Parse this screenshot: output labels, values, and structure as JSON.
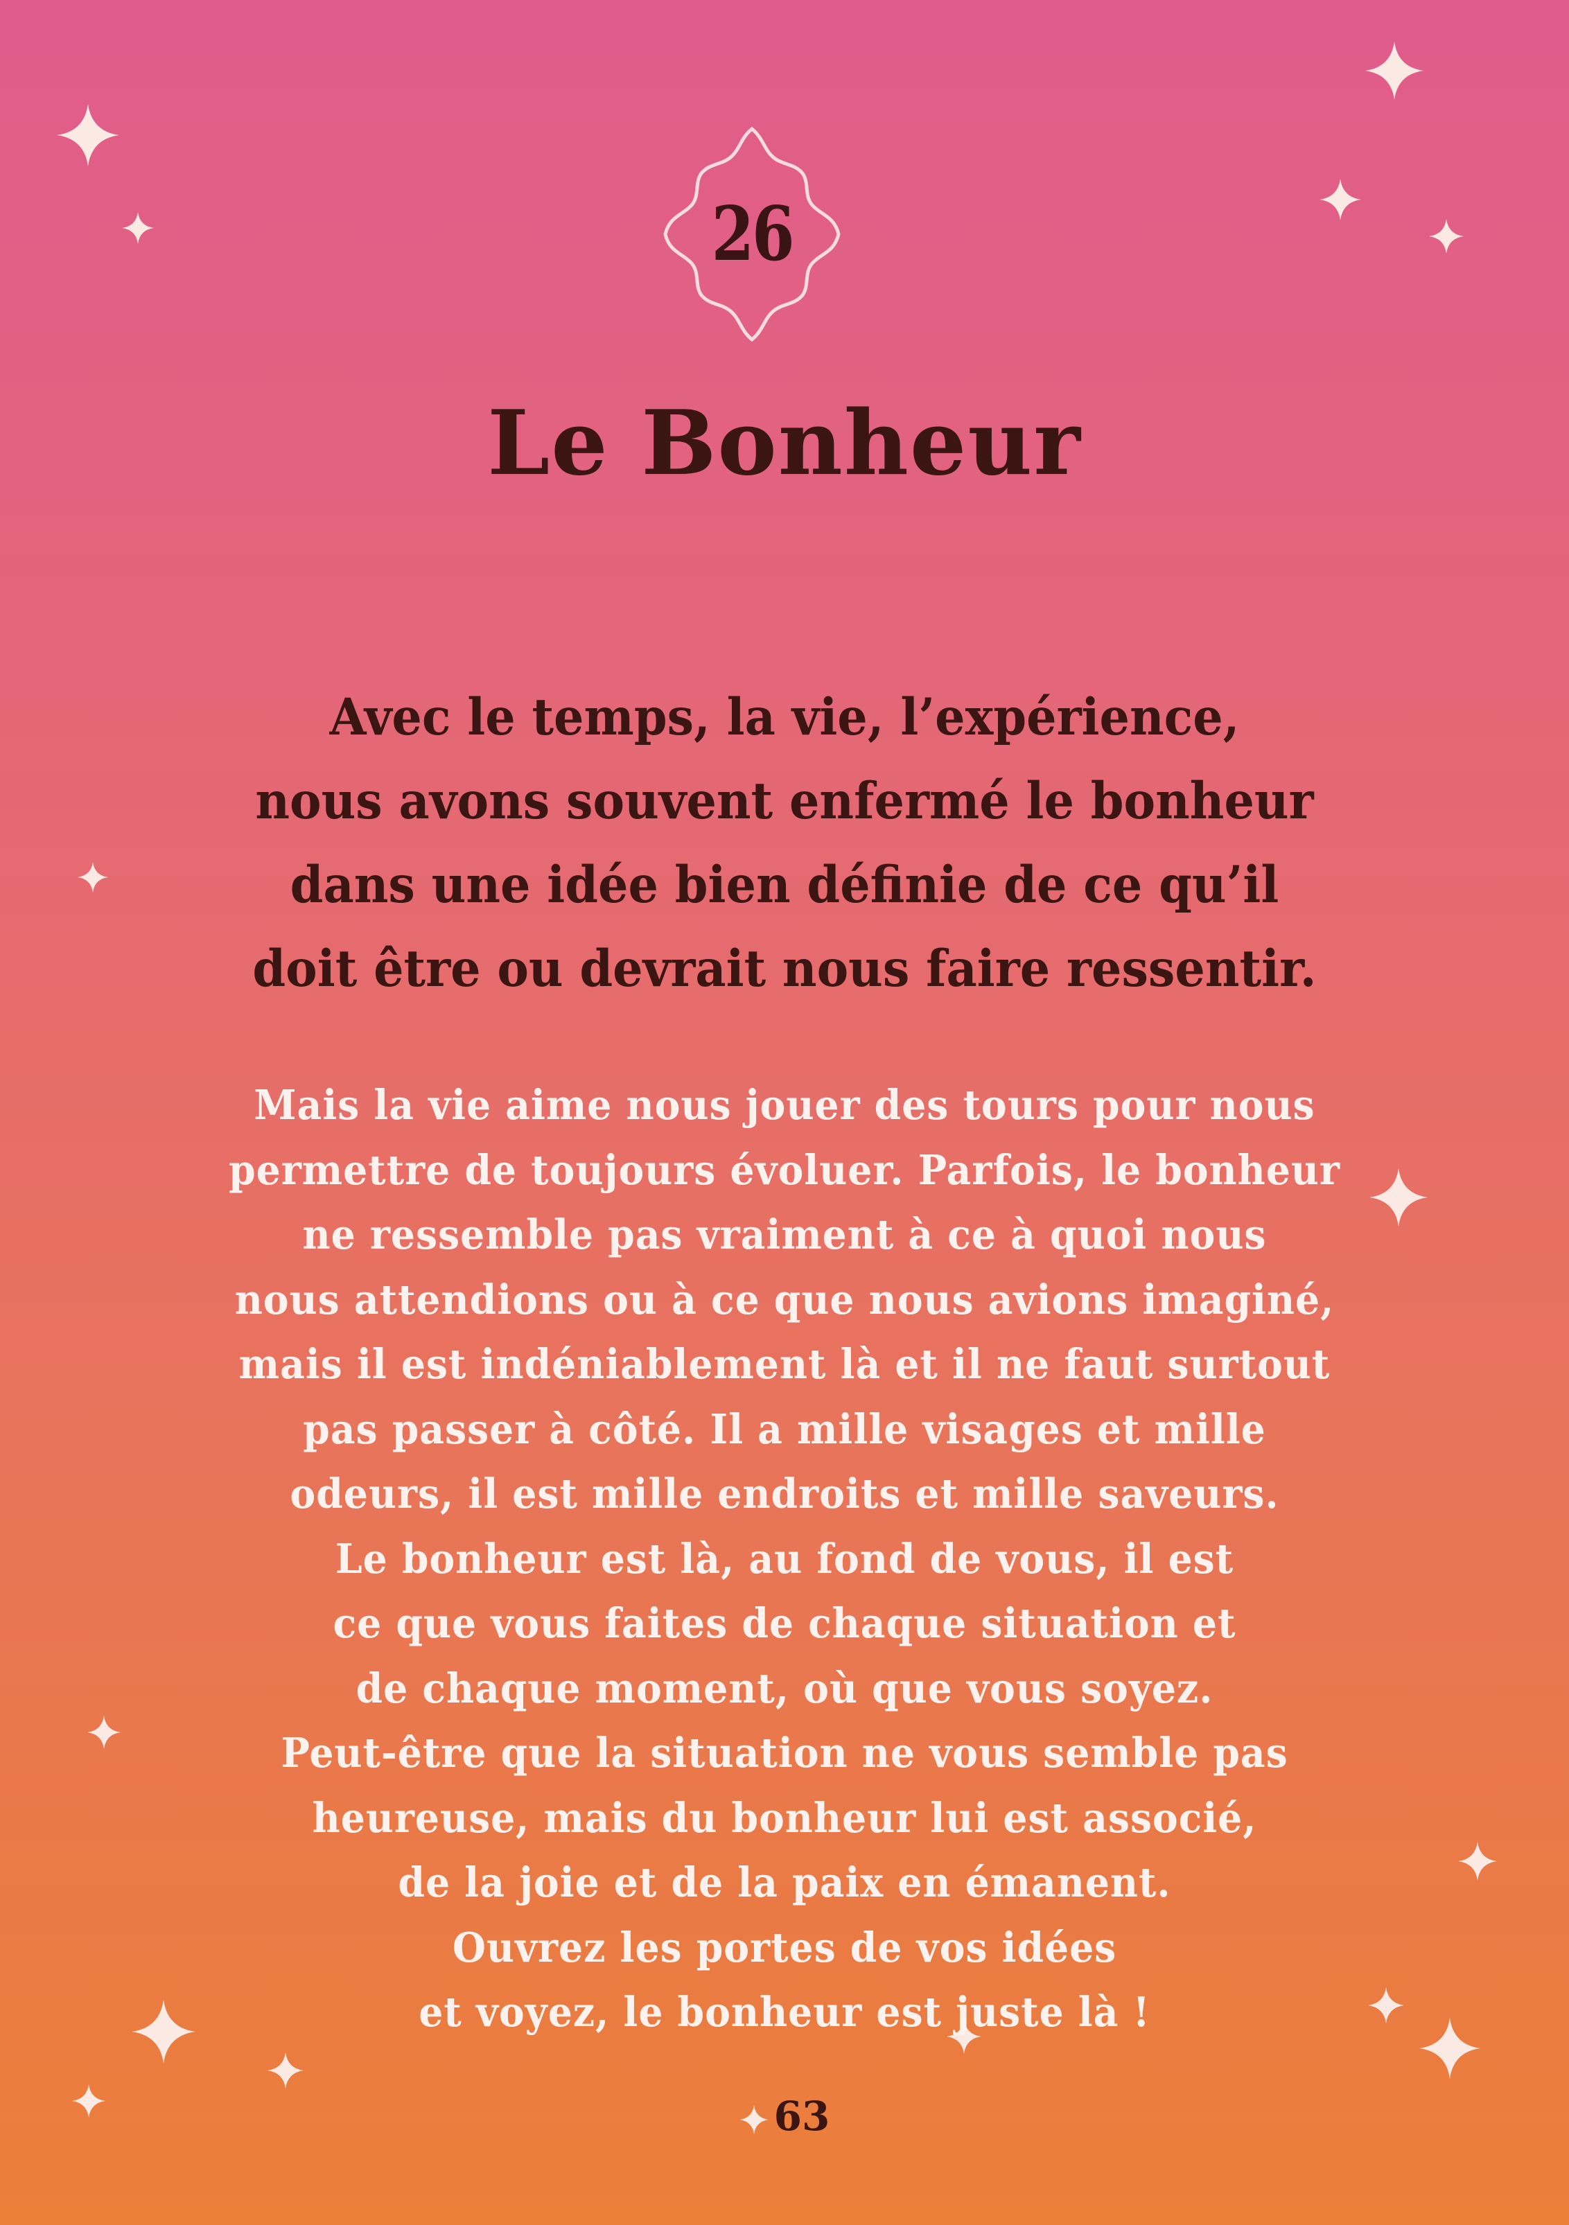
{
  "badge": {
    "number": "26"
  },
  "title": "Le Bonheur",
  "intro_lines": [
    "Avec le temps, la vie, l’expérience,",
    "nous avons souvent enfermé le bonheur",
    "dans une idée bien définie de ce qu’il",
    "doit être ou devrait nous faire ressentir."
  ],
  "body_lines": [
    "Mais la vie aime nous jouer des tours pour nous",
    "permettre de toujours évoluer. Parfois, le bonheur",
    "ne ressemble pas vraiment à ce à quoi nous",
    "nous attendions ou à ce que nous avions imaginé,",
    "mais il est indéniablement là et il ne faut surtout",
    "pas passer à côté. Il a mille visages et mille",
    "odeurs, il est mille endroits et mille saveurs.",
    "Le bonheur est là, au fond de vous, il est",
    "ce que vous faites de chaque situation et",
    "de chaque moment, où que vous soyez.",
    "Peut-être que la situation ne vous semble pas",
    "heureuse, mais du bonheur lui est associé,",
    "de la joie et de la paix en émanent.",
    "Ouvrez les portes de vos idées",
    "et voyez, le bonheur est juste là !"
  ],
  "page_number": "63",
  "colors": {
    "gradient_top": "#e05c8c",
    "gradient_bottom": "#ec7f3a",
    "heading_text": "#3a1512",
    "body_text": "#fdf2ee",
    "sparkle": "#fbe9e4"
  },
  "icons": {
    "sparkle": "four-point-star-icon",
    "badge": "scalloped-diamond-badge-icon"
  }
}
